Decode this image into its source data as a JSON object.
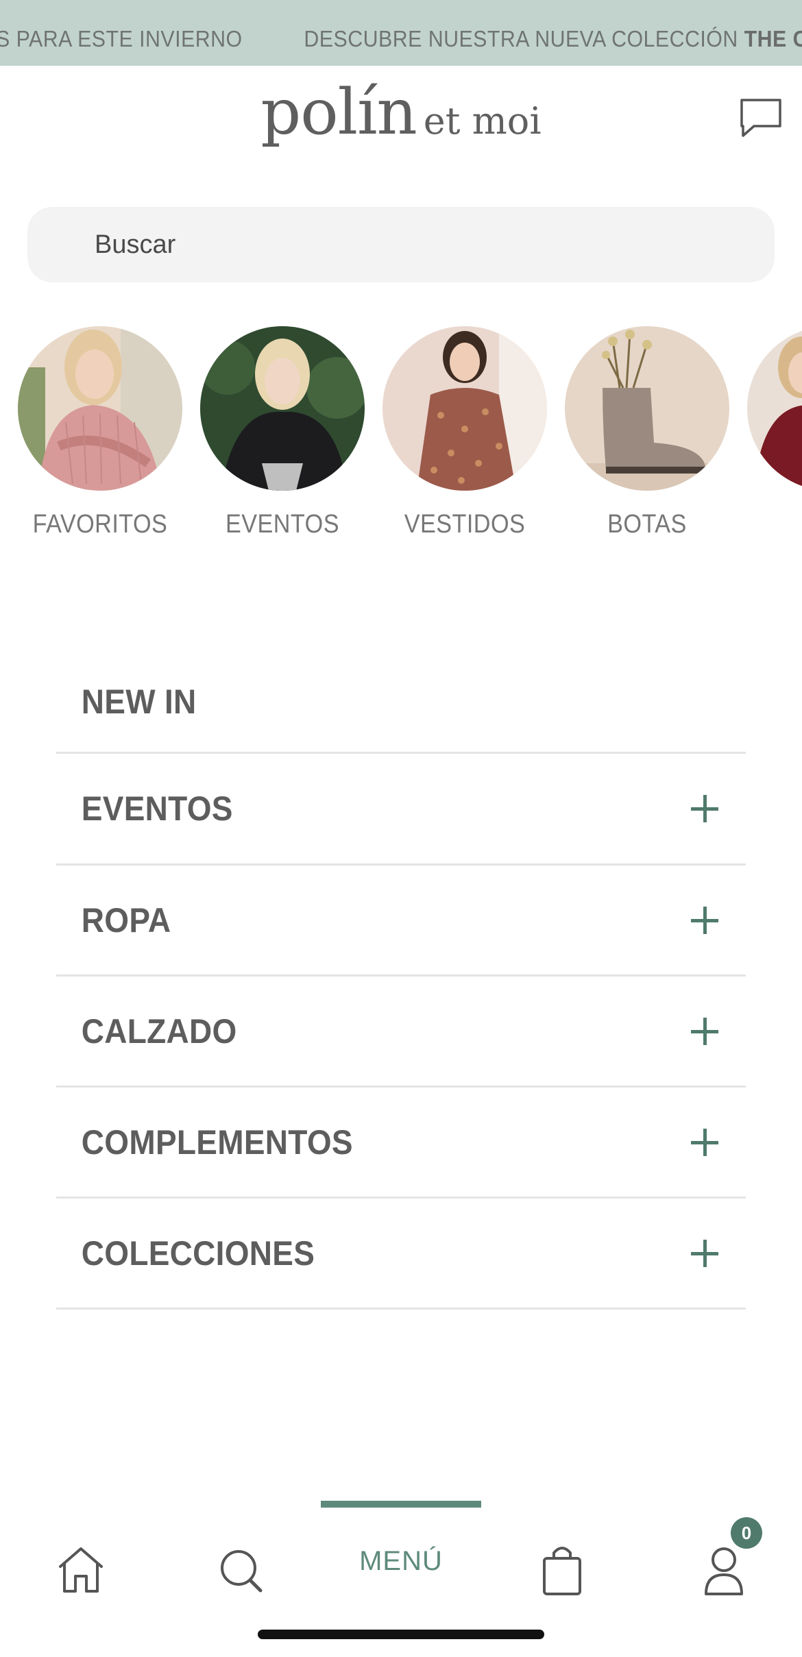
{
  "announcement": {
    "items": [
      {
        "text": "S PARA ESTE INVIERNO",
        "bold": ""
      },
      {
        "text": "DESCUBRE NUESTRA NUEVA COLECCIÓN ",
        "bold": "THE CLIMB"
      }
    ]
  },
  "header": {
    "logo_main": "polín",
    "logo_sub": "et moi",
    "chat_icon": "chat-bubble-icon"
  },
  "search": {
    "placeholder": "Buscar"
  },
  "stories": [
    {
      "label": "FAVORITOS"
    },
    {
      "label": "EVENTOS"
    },
    {
      "label": "VESTIDOS"
    },
    {
      "label": "BOTAS"
    },
    {
      "label": ""
    }
  ],
  "menu": {
    "items": [
      {
        "label": "NEW IN",
        "expandable": false
      },
      {
        "label": "EVENTOS",
        "expandable": true
      },
      {
        "label": "ROPA",
        "expandable": true
      },
      {
        "label": "CALZADO",
        "expandable": true
      },
      {
        "label": "COMPLEMENTOS",
        "expandable": true
      },
      {
        "label": "COLECCIONES",
        "expandable": true
      }
    ]
  },
  "bottom_nav": {
    "home_icon": "home-icon",
    "search_icon": "search-icon",
    "menu_label": "MENÚ",
    "bag_icon": "shopping-bag-icon",
    "account_icon": "user-icon",
    "cart_count": "0"
  },
  "colors": {
    "announce_bg": "#c2d3ce",
    "accent": "#5e8a7c",
    "text": "#5d5d5d"
  }
}
